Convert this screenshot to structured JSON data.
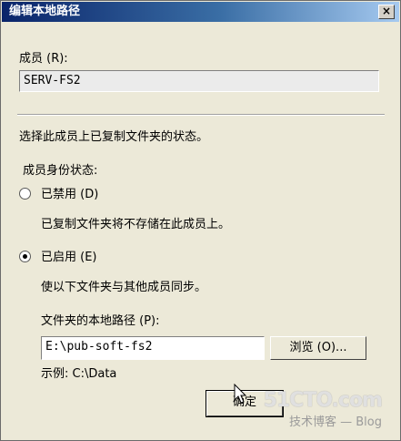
{
  "window": {
    "title": "编辑本地路径",
    "close_glyph": "×"
  },
  "member": {
    "label": "成员 (R):",
    "value": "SERV-FS2"
  },
  "status_section": {
    "intro": "选择此成员上已复制文件夹的状态。",
    "group_label": "成员身份状态:",
    "disabled_option": {
      "label": "已禁用 (D)",
      "selected": false,
      "description": "已复制文件夹将不存储在此成员上。"
    },
    "enabled_option": {
      "label": "已启用 (E)",
      "selected": true,
      "description": "使以下文件夹与其他成员同步。"
    }
  },
  "local_path": {
    "label": "文件夹的本地路径 (P):",
    "value": "E:\\pub-soft-fs2",
    "browse_label": "浏览 (O)...",
    "example": "示例: C:\\Data"
  },
  "buttons": {
    "ok_label": "确定"
  },
  "watermark": {
    "line1": "51CTO.com",
    "line2": "技术博客 — Blog"
  }
}
